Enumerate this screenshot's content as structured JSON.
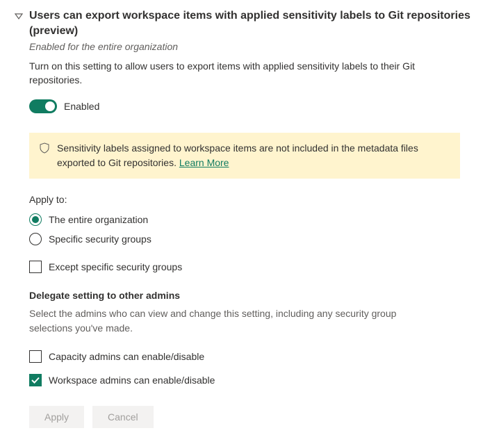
{
  "setting": {
    "title": "Users can export workspace items with applied sensitivity labels to Git repositories (preview)",
    "scope": "Enabled for the entire organization",
    "description": "Turn on this setting to allow users to export items with applied sensitivity labels to their Git repositories.",
    "toggle_label": "Enabled"
  },
  "info": {
    "text": "Sensitivity labels assigned to workspace items are not included in the metadata files exported to Git repositories. ",
    "link_label": "Learn More"
  },
  "apply": {
    "label": "Apply to:",
    "option_entire": "The entire organization",
    "option_specific": "Specific security groups",
    "except_label": "Except specific security groups"
  },
  "delegate": {
    "title": "Delegate setting to other admins",
    "description": "Select the admins who can view and change this setting, including any security group selections you've made.",
    "capacity_label": "Capacity admins can enable/disable",
    "workspace_label": "Workspace admins can enable/disable"
  },
  "buttons": {
    "apply": "Apply",
    "cancel": "Cancel"
  }
}
